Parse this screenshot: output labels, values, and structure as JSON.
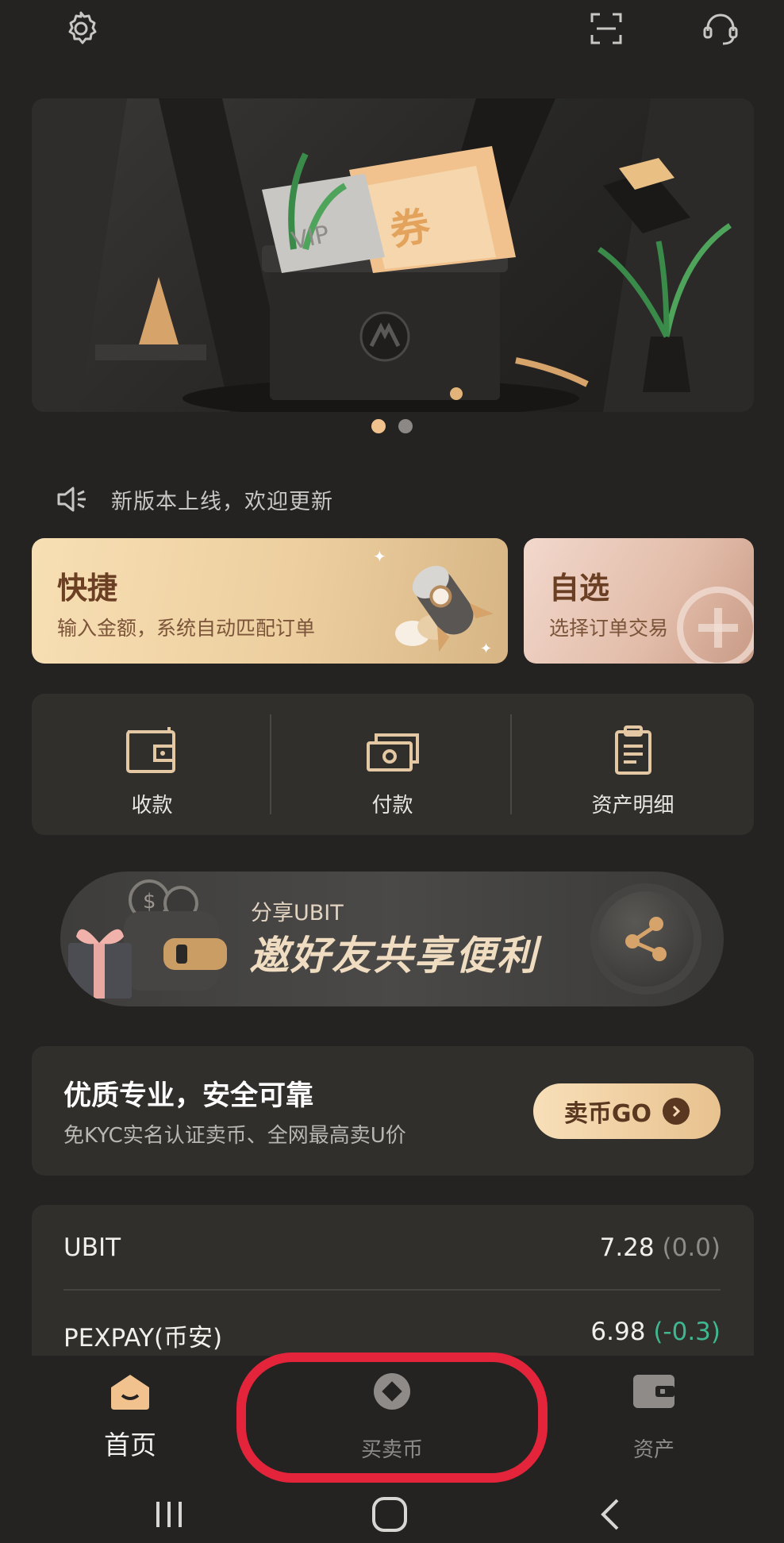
{
  "top_bar": {
    "icons": [
      "gear-icon",
      "scan-icon",
      "headset-icon"
    ]
  },
  "banner": {
    "card_text": "VIP",
    "ticket_text": "券",
    "carousel_pages": 2,
    "carousel_active": 1
  },
  "notice": {
    "icon": "speaker-icon",
    "text": "新版本上线，欢迎更新"
  },
  "cards": {
    "quick": {
      "title": "快捷",
      "subtitle": "输入金额，系统自动匹配订单"
    },
    "custom": {
      "title": "自选",
      "subtitle": "选择订单交易"
    }
  },
  "tools": [
    {
      "label": "收款",
      "icon": "wallet-icon"
    },
    {
      "label": "付款",
      "icon": "cash-icon"
    },
    {
      "label": "资产明细",
      "icon": "clipboard-icon"
    }
  ],
  "invite": {
    "small": "分享UBIT",
    "big": "邀好友共享便利",
    "icon": "share-icon"
  },
  "promo": {
    "title": "优质专业，安全可靠",
    "subtitle": "免KYC实名认证卖币、全网最高卖U价",
    "button": "卖币GO"
  },
  "prices": [
    {
      "name": "UBIT",
      "value": "7.28",
      "change": "(0.0)",
      "trend": "flat"
    },
    {
      "name": "PEXPAY(币安)",
      "value": "6.98",
      "change": "(-0.3)",
      "trend": "down"
    }
  ],
  "bottom_nav": [
    {
      "label": "首页",
      "icon": "home-icon",
      "active": true
    },
    {
      "label": "买卖币",
      "icon": "coin-icon",
      "active": false
    },
    {
      "label": "资产",
      "icon": "wallet-icon",
      "active": false
    }
  ],
  "colors": {
    "background": "#242321",
    "panel": "#302f2c",
    "accent_gold": "#f1c28d",
    "highlight_red": "#e3243b",
    "price_down": "#3fb891"
  }
}
